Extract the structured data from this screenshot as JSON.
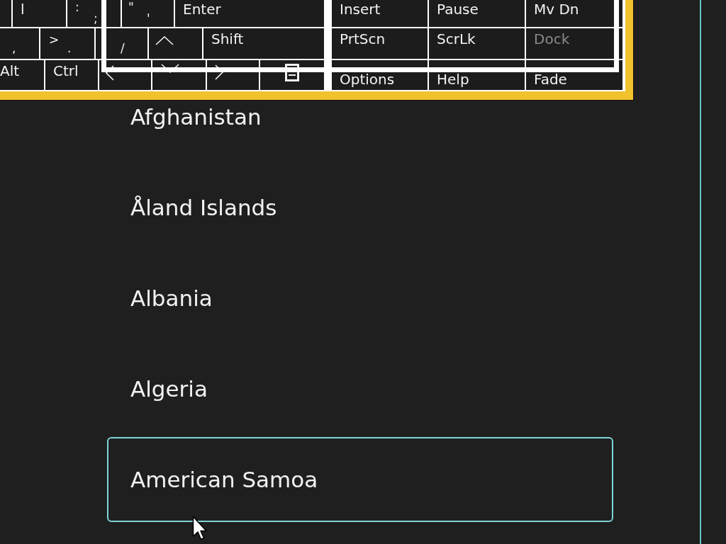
{
  "keyboard": {
    "main_rows": [
      {
        "keys": [
          {
            "kind": "blank",
            "disabled": false
          },
          {
            "kind": "label",
            "label": "l",
            "disabled": false
          },
          {
            "kind": "symbol",
            "shifted": ":",
            "base": ";",
            "disabled": false
          },
          {
            "kind": "symbol",
            "shifted": "\"",
            "base": "'",
            "disabled": false
          },
          {
            "kind": "label",
            "label": "Enter",
            "disabled": false
          }
        ]
      },
      {
        "keys": [
          {
            "kind": "symbol",
            "base": ",",
            "disabled": false
          },
          {
            "kind": "symbol",
            "shifted": ">",
            "base": ".",
            "disabled": false
          },
          {
            "kind": "symbol",
            "base": "/",
            "disabled": false
          },
          {
            "kind": "up",
            "disabled": false
          },
          {
            "kind": "label",
            "label": "Shift",
            "disabled": false
          }
        ]
      },
      {
        "keys": [
          {
            "kind": "label",
            "label": "Alt",
            "disabled": false
          },
          {
            "kind": "label",
            "label": "Ctrl",
            "disabled": false
          },
          {
            "kind": "left",
            "disabled": false
          },
          {
            "kind": "down",
            "disabled": false
          },
          {
            "kind": "right",
            "disabled": false
          },
          {
            "kind": "menu",
            "disabled": false
          }
        ]
      }
    ],
    "nav_rows": [
      {
        "keys": [
          {
            "kind": "label",
            "label": "Insert",
            "disabled": false
          },
          {
            "kind": "label",
            "label": "Pause",
            "disabled": false
          },
          {
            "kind": "label",
            "label": "Mv Dn",
            "disabled": false
          }
        ]
      },
      {
        "keys": [
          {
            "kind": "label",
            "label": "PrtScn",
            "disabled": false
          },
          {
            "kind": "label",
            "label": "ScrLk",
            "disabled": false
          },
          {
            "kind": "label",
            "label": "Dock",
            "disabled": true
          }
        ]
      },
      {
        "keys": [
          {
            "kind": "label",
            "label": "Options",
            "disabled": false
          },
          {
            "kind": "label",
            "label": "Help",
            "disabled": false
          },
          {
            "kind": "label",
            "label": "Fade",
            "disabled": false
          }
        ]
      }
    ]
  },
  "countries": [
    {
      "name": "Afghanistan",
      "selected": false
    },
    {
      "name": "Åland Islands",
      "selected": false
    },
    {
      "name": "Albania",
      "selected": false
    },
    {
      "name": "Algeria",
      "selected": false
    },
    {
      "name": "American Samoa",
      "selected": true
    }
  ]
}
